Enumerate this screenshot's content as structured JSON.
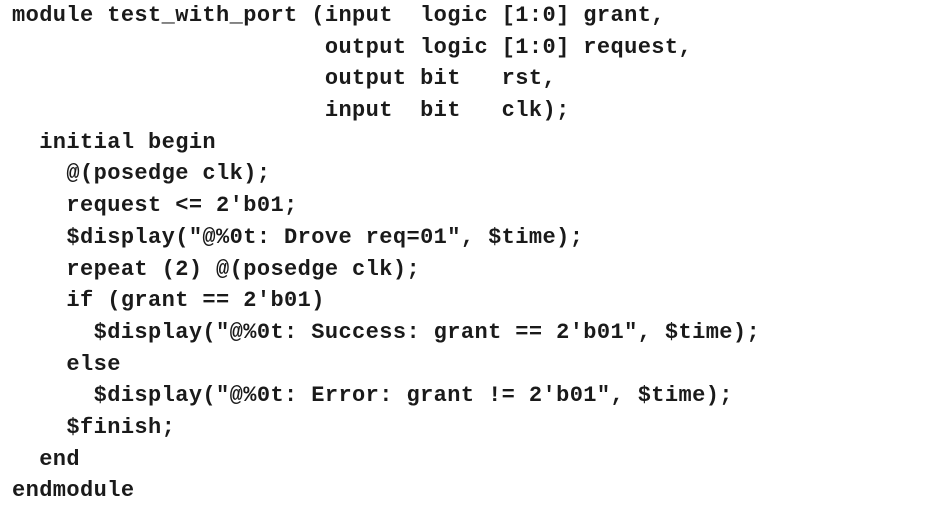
{
  "code": {
    "lines": [
      "module test_with_port (input  logic [1:0] grant,",
      "                       output logic [1:0] request,",
      "                       output bit   rst,",
      "                       input  bit   clk);",
      "  initial begin",
      "    @(posedge clk);",
      "    request <= 2'b01;",
      "    $display(\"@%0t: Drove req=01\", $time);",
      "    repeat (2) @(posedge clk);",
      "    if (grant == 2'b01)",
      "      $display(\"@%0t: Success: grant == 2'b01\", $time);",
      "    else",
      "      $display(\"@%0t: Error: grant != 2'b01\", $time);",
      "    $finish;",
      "  end",
      "endmodule"
    ]
  }
}
